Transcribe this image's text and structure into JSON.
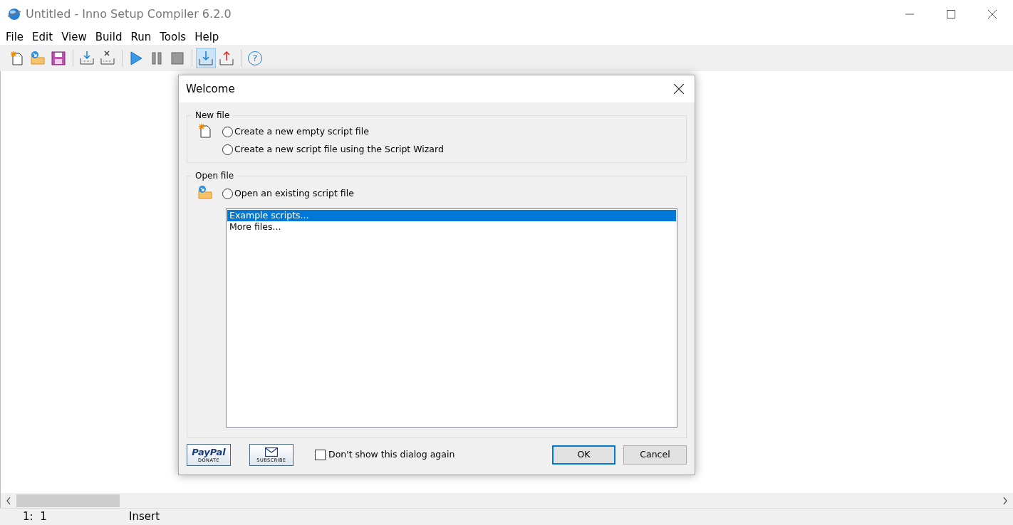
{
  "window": {
    "title": "Untitled - Inno Setup Compiler 6.2.0"
  },
  "menu": [
    "File",
    "Edit",
    "View",
    "Build",
    "Run",
    "Tools",
    "Help"
  ],
  "toolbar": {
    "groups": [
      [
        {
          "kind": "new",
          "pressed": false
        },
        {
          "kind": "open",
          "pressed": false
        },
        {
          "kind": "save",
          "pressed": false
        }
      ],
      [
        {
          "kind": "compile",
          "pressed": false
        },
        {
          "kind": "stop",
          "pressed": false
        }
      ],
      [
        {
          "kind": "run",
          "pressed": false
        },
        {
          "kind": "pause",
          "pressed": false
        },
        {
          "kind": "terminate",
          "pressed": false
        }
      ],
      [
        {
          "kind": "target-in",
          "pressed": true
        },
        {
          "kind": "target-out",
          "pressed": false
        }
      ],
      [
        {
          "kind": "help",
          "pressed": false,
          "glyph": "?"
        }
      ]
    ]
  },
  "dialog": {
    "title": "Welcome",
    "new_file": {
      "label": "New file",
      "options": [
        {
          "label": "Create a new empty script file",
          "selected": false
        },
        {
          "label": "Create a new script file using the Script Wizard",
          "selected": false
        }
      ]
    },
    "open_file": {
      "label": "Open file",
      "option": {
        "label": "Open an existing script file",
        "selected": false
      },
      "files": [
        {
          "label": "Example scripts...",
          "selected": true
        },
        {
          "label": "More files...",
          "selected": false
        }
      ]
    },
    "donate": {
      "brand": "PayPal",
      "label": "DONATE"
    },
    "subscribe": {
      "label": "SUBSCRIBE"
    },
    "dont_show": {
      "label": "Don't show this dialog again",
      "checked": false
    },
    "buttons": [
      {
        "label": "OK",
        "default": true
      },
      {
        "label": "Cancel",
        "default": false
      }
    ]
  },
  "status_bar": {
    "position": "1:  1",
    "mode": "Insert"
  }
}
